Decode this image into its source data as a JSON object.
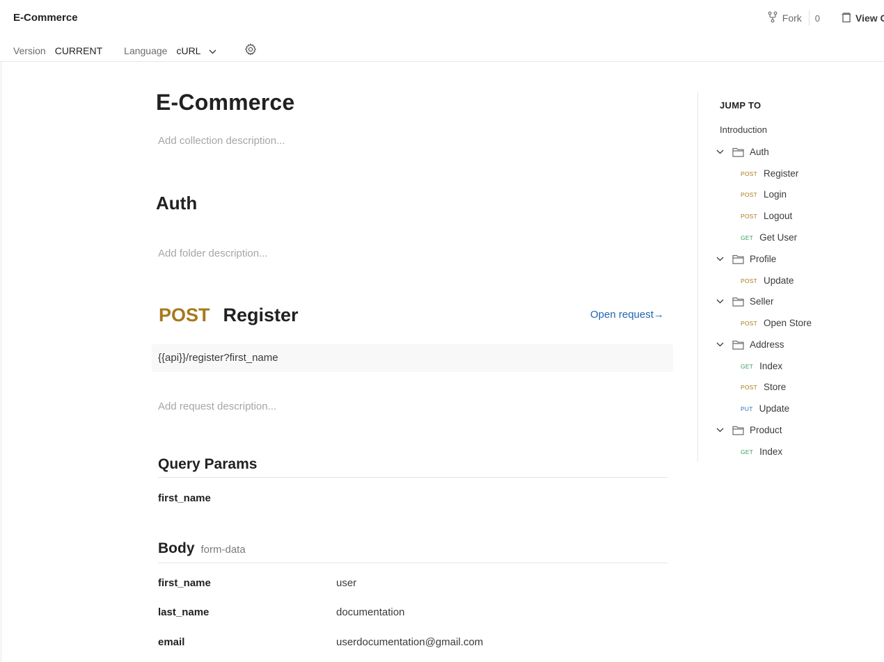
{
  "header": {
    "title": "E-Commerce",
    "fork_label": "Fork",
    "fork_count": "0",
    "view_label": "View C",
    "version_label": "Version",
    "version_value": "CURRENT",
    "language_label": "Language",
    "language_value": "cURL"
  },
  "collection": {
    "title": "E-Commerce",
    "description_placeholder": "Add collection description..."
  },
  "folder": {
    "title": "Auth",
    "description_placeholder": "Add folder description..."
  },
  "request": {
    "method": "POST",
    "name": "Register",
    "open_label": "Open request→",
    "url": "{{api}}/register?first_name",
    "description_placeholder": "Add request description..."
  },
  "query_params": {
    "title": "Query Params",
    "items": [
      {
        "key": "first_name",
        "value": ""
      }
    ]
  },
  "body": {
    "title": "Body",
    "type": "form-data",
    "items": [
      {
        "key": "first_name",
        "value": "user"
      },
      {
        "key": "last_name",
        "value": "documentation"
      },
      {
        "key": "email",
        "value": "userdocumentation@gmail.com"
      }
    ]
  },
  "toc": {
    "heading": "JUMP TO",
    "intro": "Introduction",
    "folders": [
      {
        "name": "Auth",
        "requests": [
          {
            "method": "POST",
            "name": "Register"
          },
          {
            "method": "POST",
            "name": "Login"
          },
          {
            "method": "POST",
            "name": "Logout"
          },
          {
            "method": "GET",
            "name": "Get User"
          }
        ]
      },
      {
        "name": "Profile",
        "requests": [
          {
            "method": "POST",
            "name": "Update"
          }
        ]
      },
      {
        "name": "Seller",
        "requests": [
          {
            "method": "POST",
            "name": "Open Store"
          }
        ]
      },
      {
        "name": "Address",
        "requests": [
          {
            "method": "GET",
            "name": "Index"
          },
          {
            "method": "POST",
            "name": "Store"
          },
          {
            "method": "PUT",
            "name": "Update"
          }
        ]
      },
      {
        "name": "Product",
        "requests": [
          {
            "method": "GET",
            "name": "Index"
          }
        ]
      }
    ]
  },
  "colors": {
    "post": "#a8781c",
    "get": "#3a9a5e",
    "put": "#2b6fc2",
    "link": "#1f64b3"
  },
  "icons": [
    "fork-icon",
    "collection-icon",
    "chevron-down-icon",
    "gear-icon",
    "folder-icon"
  ]
}
